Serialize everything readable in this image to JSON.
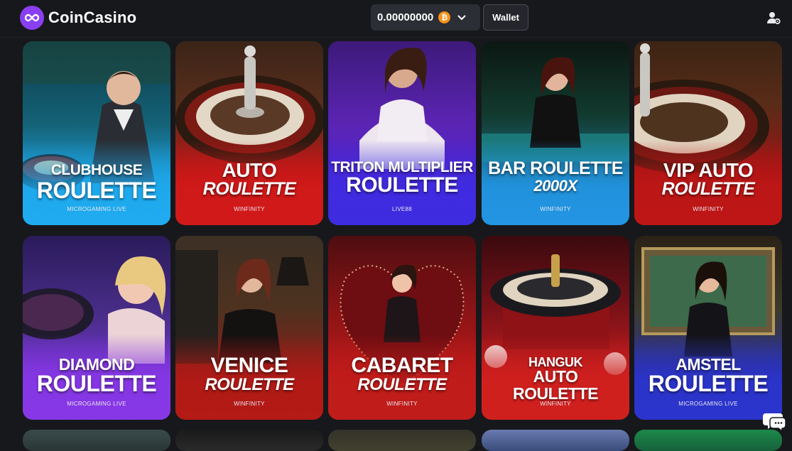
{
  "header": {
    "brand": "CoinCasino",
    "balance": "0.00000000",
    "currency_icon": "bitcoin-icon",
    "wallet_label": "Wallet"
  },
  "games": [
    {
      "line1": "CLUBHOUSE",
      "line2": "ROULETTE",
      "provider": "MICROGAMING LIVE"
    },
    {
      "line1": "AUTO",
      "line2": "ROULETTE",
      "provider": "WINFINITY"
    },
    {
      "line1": "TRITON MULTIPLIER",
      "line2": "ROULETTE",
      "provider": "LIVE88"
    },
    {
      "line1": "BAR ROULETTE",
      "line2": "2000X",
      "provider": "WINFINITY"
    },
    {
      "line1": "VIP AUTO",
      "line2": "ROULETTE",
      "provider": "WINFINITY"
    },
    {
      "line1": "DIAMOND",
      "line2": "ROULETTE",
      "provider": "MICROGAMING LIVE"
    },
    {
      "line1": "VENICE",
      "line2": "ROULETTE",
      "provider": "WINFINITY"
    },
    {
      "line1": "CABARET",
      "line2": "ROULETTE",
      "provider": "WINFINITY"
    },
    {
      "line1": "HANGUK",
      "line2": "AUTO ROULETTE",
      "provider": "WINFINITY"
    },
    {
      "line1": "AMSTEL",
      "line2": "ROULETTE",
      "provider": "MICROGAMING LIVE"
    }
  ],
  "colors": {
    "brand": "#8a3ff2",
    "background": "#17181c",
    "bitcoin": "#f7931a"
  }
}
